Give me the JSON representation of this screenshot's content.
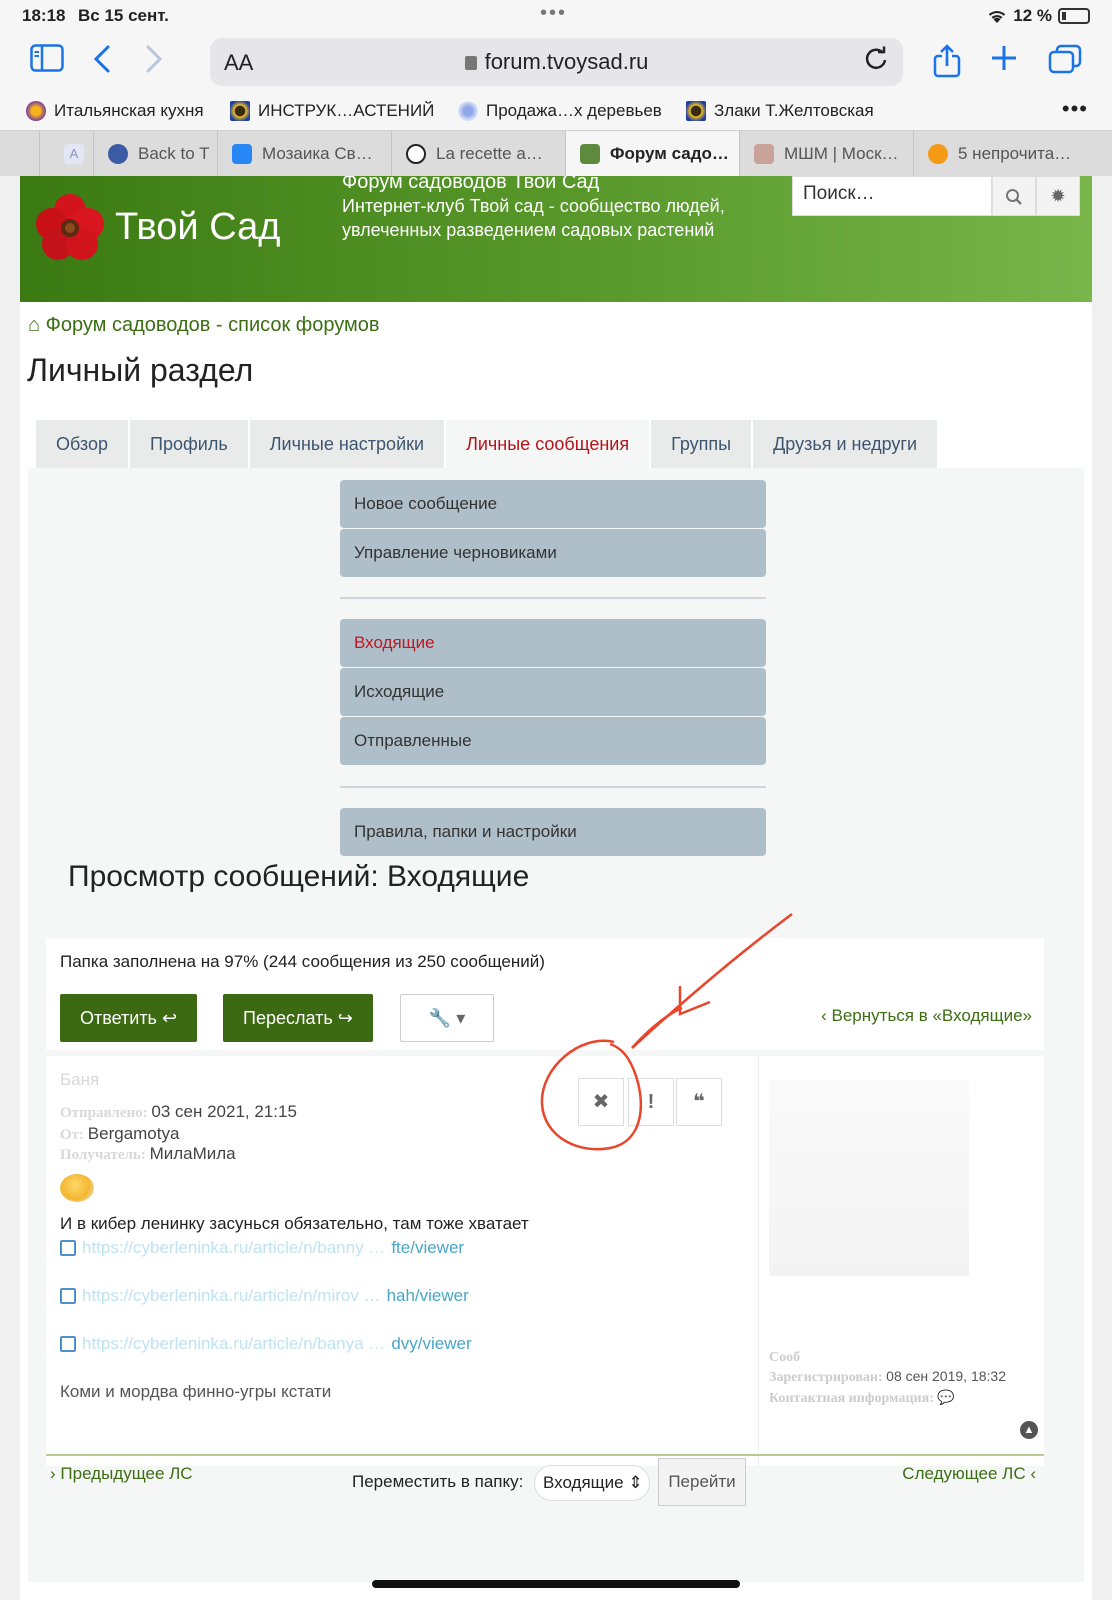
{
  "status": {
    "time": "18:18",
    "date": "Вс 15 сент.",
    "battery": "12 %"
  },
  "browser": {
    "aa_label": "AA",
    "url": "forum.tvoysad.ru"
  },
  "bookmarks": [
    {
      "label": "Итальянская кухня",
      "icon": "italian-food-favicon"
    },
    {
      "label": "ИНСТРУК…АСТЕНИЙ",
      "icon": "sunflower-favicon"
    },
    {
      "label": "Продажа…х деревьев",
      "icon": "tree-favicon"
    },
    {
      "label": "Злаки Т.Желтовская",
      "icon": "sunflower-favicon"
    }
  ],
  "tabs": [
    {
      "label": ""
    },
    {
      "label": "Back to T"
    },
    {
      "label": "Мозаика Св…"
    },
    {
      "label": "La recette a…"
    },
    {
      "label": "Форум садо…"
    },
    {
      "label": "МШМ | Моск…"
    },
    {
      "label": "5 непрочита…"
    }
  ],
  "site": {
    "logo_text": "Твой Сад",
    "header_title": "Форум садоводов Твой Сад",
    "header_desc": "Интернет-клуб Твой сад - сообщество людей, увлеченных разведением садовых растений",
    "search_placeholder": "Поиск…",
    "breadcrumb": "Форум садоводов - список форумов",
    "page_title": "Личный раздел"
  },
  "section_tabs": [
    "Обзор",
    "Профиль",
    "Личные настройки",
    "Личные сообщения",
    "Группы",
    "Друзья и недруги"
  ],
  "pm_menu": {
    "top": [
      "Новое сообщение",
      "Управление черновиками"
    ],
    "folders": [
      "Входящие",
      "Исходящие",
      "Отправленные"
    ],
    "bottom": [
      "Правила, папки и настройки"
    ]
  },
  "view": {
    "title": "Просмотр сообщений: Входящие",
    "folder_status": "Папка заполнена на 97% (244 сообщения из 250 сообщений)",
    "reply_label": "Ответить",
    "forward_label": "Переслать",
    "back_link": "Вернуться в «Входящие»"
  },
  "post": {
    "subject": "Баня",
    "sent_label": "Отправлено:",
    "sent_value": "03 сен 2021, 21:15",
    "from_label": "От:",
    "from_value": "Bergamotya",
    "to_label": "Получатель:",
    "to_value": "МилаМила",
    "text1": "И в кибер ленинку засунься обязательно, там тоже хватает",
    "links": [
      {
        "faint": "https://cyberleninka.ru/article/n/banny … ",
        "dark": "fte/viewer"
      },
      {
        "faint": "https://cyberleninka.ru/article/n/mirov … ",
        "dark": "hah/viewer"
      },
      {
        "faint": "https://cyberleninka.ru/article/n/banya … ",
        "dark": "dvy/viewer"
      }
    ],
    "text2": "Коми и мордва финно-угры кстати"
  },
  "profile": {
    "messages_label": "Сооб",
    "registered_label": "Зарегистрирован:",
    "registered_value": "08 сен 2019, 18:32",
    "contact_label": "Контактная информация:"
  },
  "nav": {
    "prev": "Предыдущее ЛС",
    "next": "Следующее ЛС",
    "move_label": "Переместить в папку:",
    "move_value": "Входящие",
    "go_label": "Перейти"
  },
  "colors": {
    "accent_green": "#3b6a12",
    "active_red": "#c01721",
    "annotation": "#e8452a"
  }
}
